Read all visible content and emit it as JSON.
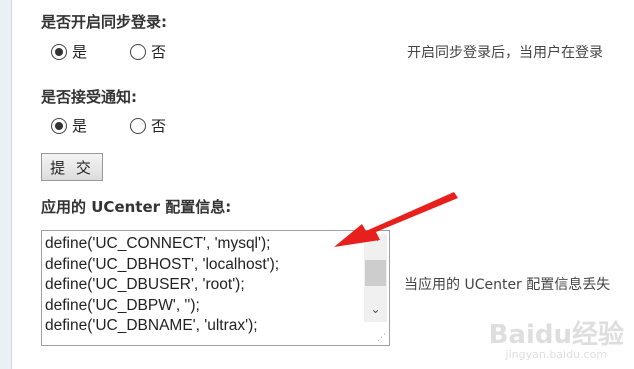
{
  "sync_login": {
    "label": "是否开启同步登录:",
    "options": [
      {
        "label": "是",
        "checked": true
      },
      {
        "label": "否",
        "checked": false
      }
    ],
    "hint": "开启同步登录后，当用户在登录"
  },
  "accept_notify": {
    "label": "是否接受通知:",
    "options": [
      {
        "label": "是",
        "checked": true
      },
      {
        "label": "否",
        "checked": false
      }
    ]
  },
  "submit_label": "提 交",
  "ucenter_config": {
    "label_prefix": "应用的",
    "label_brand": "UCenter",
    "label_suffix": "配置信息:",
    "lines": [
      "define('UC_CONNECT', 'mysql');",
      "define('UC_DBHOST', 'localhost');",
      "define('UC_DBUSER', 'root');",
      "define('UC_DBPW', '');",
      "define('UC_DBNAME', 'ultrax');"
    ],
    "hint": "当应用的 UCenter 配置信息丢失"
  },
  "annotation": {
    "arrow_color": "#e8201d"
  },
  "watermark": {
    "logo": "Baidu经验",
    "url": "jingyan.baidu.com"
  }
}
